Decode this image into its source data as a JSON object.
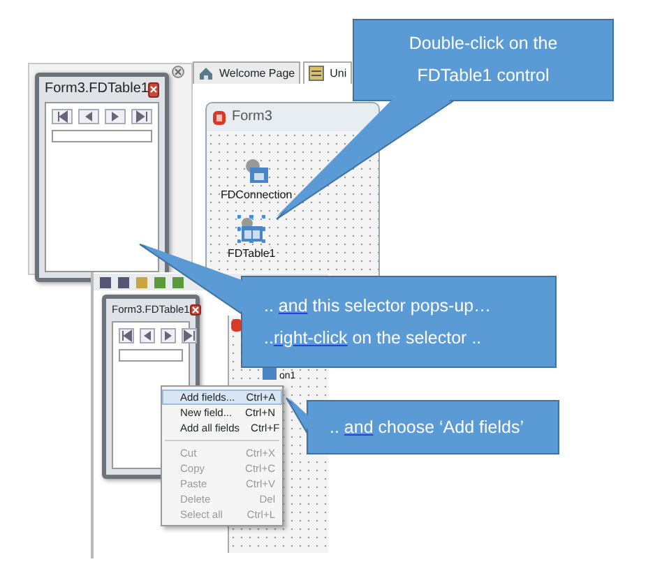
{
  "dock_window": {
    "title": "Form3.FDTable1"
  },
  "tabs": [
    {
      "label": "Welcome Page",
      "selected": false
    },
    {
      "label": "Uni",
      "selected": true
    }
  ],
  "form_designer": {
    "title": "Form3",
    "components": [
      {
        "kind": "connection",
        "label": "FDConnection",
        "selected": false
      },
      {
        "kind": "table",
        "label": "FDTable1",
        "selected": true
      }
    ]
  },
  "popup_window": {
    "title": "Form3.FDTable1"
  },
  "second_form": {
    "label": "on1"
  },
  "context_menu": {
    "items": [
      {
        "kind": "item",
        "label": "Add fields...",
        "shortcut": "Ctrl+A",
        "selected": true,
        "disabled": false
      },
      {
        "kind": "item",
        "label": "New field...",
        "shortcut": "Ctrl+N",
        "selected": false,
        "disabled": false
      },
      {
        "kind": "item",
        "label": "Add all fields",
        "shortcut": "Ctrl+F",
        "selected": false,
        "disabled": false
      },
      {
        "kind": "separator"
      },
      {
        "kind": "item",
        "label": "Cut",
        "shortcut": "Ctrl+X",
        "selected": false,
        "disabled": true
      },
      {
        "kind": "item",
        "label": "Copy",
        "shortcut": "Ctrl+C",
        "selected": false,
        "disabled": true
      },
      {
        "kind": "item",
        "label": "Paste",
        "shortcut": "Ctrl+V",
        "selected": false,
        "disabled": true
      },
      {
        "kind": "item",
        "label": "Delete",
        "shortcut": "Del",
        "selected": false,
        "disabled": true
      },
      {
        "kind": "item",
        "label": "Select all",
        "shortcut": "Ctrl+L",
        "selected": false,
        "disabled": true
      }
    ]
  },
  "callouts": [
    {
      "centered": true,
      "lines": [
        [
          {
            "text": "Double-click on the",
            "underlined": false
          }
        ],
        [
          {
            "text": "FDTable1 control",
            "underlined": false
          }
        ]
      ]
    },
    {
      "centered": false,
      "lines": [
        [
          {
            "text": ".. ",
            "underlined": false
          },
          {
            "text": "and",
            "underlined": true
          },
          {
            "text": " this selector pops-up…",
            "underlined": false
          }
        ],
        [
          {
            "text": "..",
            "underlined": false
          },
          {
            "text": "right-click",
            "underlined": true
          },
          {
            "text": " on the selector ..",
            "underlined": false
          }
        ]
      ]
    },
    {
      "centered": false,
      "lines": [
        [
          {
            "text": ".. ",
            "underlined": false
          },
          {
            "text": "and",
            "underlined": true
          },
          {
            "text": " choose ‘Add fields’",
            "underlined": false
          }
        ]
      ]
    }
  ]
}
